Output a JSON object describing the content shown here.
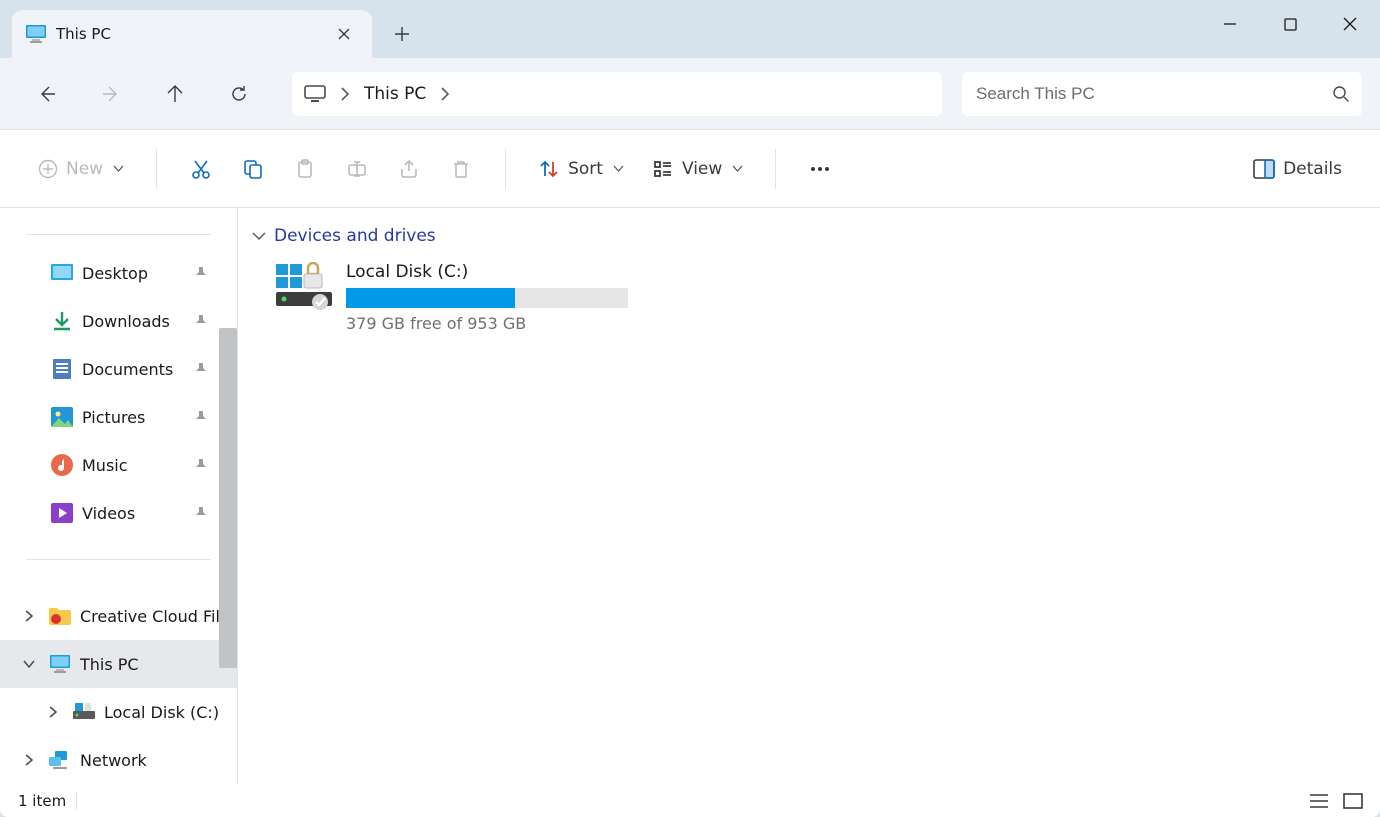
{
  "tab": {
    "title": "This PC"
  },
  "address": {
    "location": "This PC"
  },
  "search": {
    "placeholder": "Search This PC"
  },
  "toolbar": {
    "new_label": "New",
    "sort_label": "Sort",
    "view_label": "View",
    "details_label": "Details"
  },
  "sidebar": {
    "quick": [
      {
        "label": "Desktop"
      },
      {
        "label": "Downloads"
      },
      {
        "label": "Documents"
      },
      {
        "label": "Pictures"
      },
      {
        "label": "Music"
      },
      {
        "label": "Videos"
      }
    ],
    "tree": [
      {
        "label": "Creative Cloud Files"
      },
      {
        "label": "This PC"
      },
      {
        "label": "Local Disk (C:)"
      },
      {
        "label": "Network"
      }
    ]
  },
  "content": {
    "section_label": "Devices and drives",
    "drive": {
      "name": "Local Disk (C:)",
      "free_text": "379 GB free of 953 GB",
      "used_percent": 60
    }
  },
  "status": {
    "item_count_text": "1 item"
  }
}
